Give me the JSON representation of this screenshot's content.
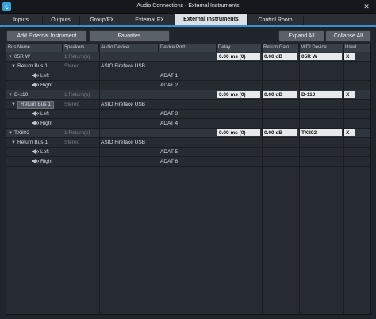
{
  "window": {
    "title": "Audio Connections - External Instruments",
    "close_glyph": "✕"
  },
  "tabs": [
    {
      "label": "Inputs"
    },
    {
      "label": "Outputs"
    },
    {
      "label": "Group/FX"
    },
    {
      "label": "External FX"
    },
    {
      "label": "External Instruments",
      "active": true
    },
    {
      "label": "Control Room"
    }
  ],
  "toolbar": {
    "add_label": "Add External Instrument",
    "favorites_label": "Favorites",
    "expand_label": "Expand All",
    "collapse_label": "Collapse All"
  },
  "columns": [
    "Bus Name",
    "Speakers",
    "Audio Device",
    "Device Port",
    "Delay",
    "Return Gain",
    "MIDI Device",
    "Used"
  ],
  "rows": [
    {
      "type": "parent",
      "name": "05R W",
      "speakers": "1 Return(s)",
      "delay": "0.00 ms (0)",
      "gain": "0.00 dB",
      "midi": "05R W",
      "used": "X"
    },
    {
      "type": "bus",
      "name": "Return Bus 1",
      "speakers": "Stereo",
      "device": "ASIO Fireface USB"
    },
    {
      "type": "chan",
      "name": "Left",
      "port": "ADAT 1"
    },
    {
      "type": "chan",
      "name": "Right",
      "port": "ADAT 2"
    },
    {
      "type": "parent",
      "name": "D-110",
      "speakers": "1 Return(s)",
      "delay": "0.00 ms (0)",
      "gain": "0.00 dB",
      "midi": "D-110",
      "used": "X"
    },
    {
      "type": "bus",
      "name": "Return Bus 1",
      "speakers": "Stereo",
      "device": "ASIO Fireface USB",
      "selected": true
    },
    {
      "type": "chan",
      "name": "Left",
      "port": "ADAT 3"
    },
    {
      "type": "chan",
      "name": "Right",
      "port": "ADAT 4"
    },
    {
      "type": "parent",
      "name": "TX802",
      "speakers": "1 Return(s)",
      "delay": "0.00 ms (0)",
      "gain": "0.00 dB",
      "midi": "TX802",
      "used": "X"
    },
    {
      "type": "bus",
      "name": "Return Bus 1",
      "speakers": "Stereo",
      "device": "ASIO Fireface USB"
    },
    {
      "type": "chan",
      "name": "Left",
      "port": "ADAT 5"
    },
    {
      "type": "chan",
      "name": "Right",
      "port": "ADAT 6"
    }
  ],
  "colors": {
    "accent": "#3d8fcf",
    "field": "#e6e8eb"
  },
  "icons": {
    "expand": "chevron-down-icon",
    "speaker": "speaker-icon",
    "app": "cubase-logo-icon"
  }
}
